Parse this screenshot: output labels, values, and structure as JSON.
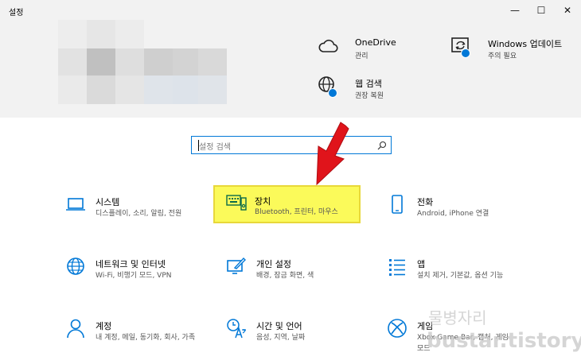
{
  "window": {
    "title": "설정",
    "minimize": "—",
    "maximize": "☐",
    "close": "✕"
  },
  "header": {
    "items": [
      {
        "title": "OneDrive",
        "sub": "관리",
        "icon": "cloud-icon"
      },
      {
        "title": "Windows 업데이트",
        "sub": "주의 필요",
        "icon": "sync-icon"
      },
      {
        "title": "웹 검색",
        "sub": "권장 복원",
        "icon": "globe-icon"
      }
    ]
  },
  "search": {
    "placeholder": "설정 검색"
  },
  "tiles": [
    {
      "title": "시스템",
      "sub": "디스플레이, 소리, 알림, 전원",
      "icon": "laptop-icon"
    },
    {
      "title": "장치",
      "sub": "Bluetooth, 프린터, 마우스",
      "icon": "keyboard-device-icon"
    },
    {
      "title": "전화",
      "sub": "Android, iPhone 연결",
      "icon": "phone-icon"
    },
    {
      "title": "네트워크 및 인터넷",
      "sub": "Wi-Fi, 비행기 모드, VPN",
      "icon": "globe-icon"
    },
    {
      "title": "개인 설정",
      "sub": "배경, 잠금 화면, 색",
      "icon": "paint-icon"
    },
    {
      "title": "앱",
      "sub": "설치 제거, 기본값, 옵션 기능",
      "icon": "apps-list-icon"
    },
    {
      "title": "계정",
      "sub": "내 계정, 메일, 동기화, 회사, 가족",
      "icon": "person-icon"
    },
    {
      "title": "시간 및 언어",
      "sub": "음성, 지역, 날짜",
      "icon": "time-language-icon"
    },
    {
      "title": "게임",
      "sub": "Xbox Game Bar, 캡처, 게임 모드",
      "icon": "xbox-icon"
    }
  ],
  "watermark": {
    "line1": "물병자리",
    "line2": "bustar.tistory"
  },
  "colors": {
    "accent": "#0078d7",
    "highlight": "#fbfa5a",
    "arrow": "#e0141b"
  }
}
